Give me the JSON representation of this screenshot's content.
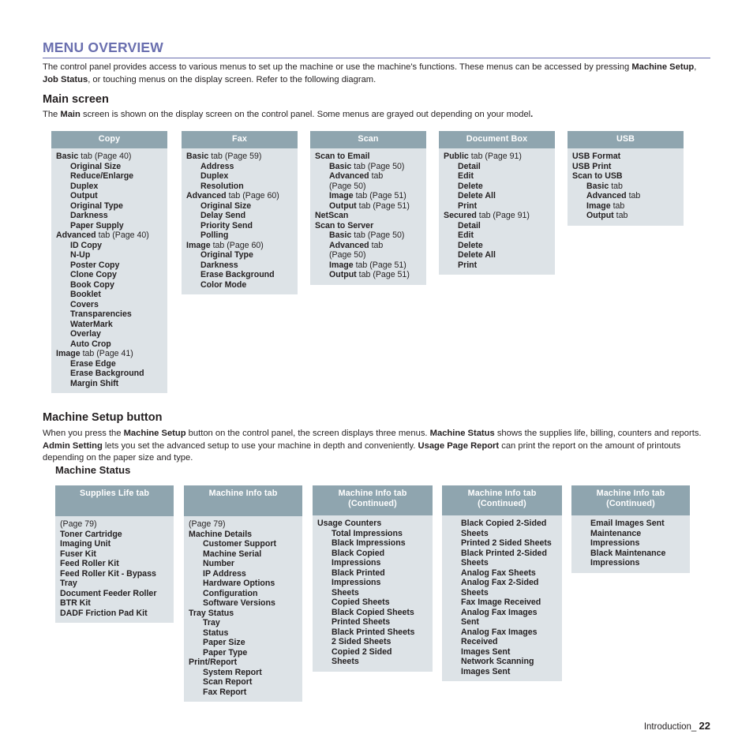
{
  "document": {
    "title": "MENU OVERVIEW",
    "intro_paragraph_html": "The control panel provides access to various menus to set up the machine or use the machine's functions. These menus can be accessed by pressing <b>Machine Setup</b>, <b>Job Status</b>, or touching menus on the display screen. Refer to the following diagram.",
    "main_screen_heading": "Main screen",
    "main_screen_paragraph_html": "The <b>Main</b> screen is shown on the display screen on the control panel. Some menus are grayed out depending on your model<b>.</b>",
    "machine_setup_heading": "Machine Setup button",
    "machine_setup_paragraph_html": "When you press the <b>Machine Setup</b> button on the control panel, the screen displays three menus. <b>Machine Status</b> shows the supplies life, billing, counters and reports. <b>Admin Setting</b> lets you set the advanced setup to use your machine in depth and conveniently. <b>Usage Page Report</b> can print the report on the amount of printouts depending on the paper size and type.",
    "machine_status_heading": "Machine Status",
    "footer_label": "Introduction_",
    "footer_page": "22"
  },
  "colors": {
    "heading_purple": "#6a6faf",
    "box_header_bg": "#8fa5af",
    "box_body_bg": "#dde3e7",
    "text": "#231f20"
  },
  "main_screen_columns": [
    {
      "header": "Copy",
      "items": [
        {
          "level": 0,
          "bold": "Basic",
          "rest": " tab (Page 40)"
        },
        {
          "level": 1,
          "bold": "Original Size",
          "rest": ""
        },
        {
          "level": 1,
          "bold": "Reduce/Enlarge",
          "rest": ""
        },
        {
          "level": 1,
          "bold": "Duplex",
          "rest": ""
        },
        {
          "level": 1,
          "bold": "Output",
          "rest": ""
        },
        {
          "level": 1,
          "bold": "Original Type",
          "rest": ""
        },
        {
          "level": 1,
          "bold": "Darkness",
          "rest": ""
        },
        {
          "level": 1,
          "bold": "Paper Supply",
          "rest": ""
        },
        {
          "level": 0,
          "bold": "Advanced",
          "rest": " tab (Page 40)"
        },
        {
          "level": 1,
          "bold": "ID Copy",
          "rest": ""
        },
        {
          "level": 1,
          "bold": "N-Up",
          "rest": ""
        },
        {
          "level": 1,
          "bold": "Poster Copy",
          "rest": ""
        },
        {
          "level": 1,
          "bold": "Clone Copy",
          "rest": ""
        },
        {
          "level": 1,
          "bold": "Book Copy",
          "rest": ""
        },
        {
          "level": 1,
          "bold": "Booklet",
          "rest": ""
        },
        {
          "level": 1,
          "bold": "Covers",
          "rest": ""
        },
        {
          "level": 1,
          "bold": "Transparencies",
          "rest": ""
        },
        {
          "level": 1,
          "bold": "WaterMark",
          "rest": ""
        },
        {
          "level": 1,
          "bold": "Overlay",
          "rest": ""
        },
        {
          "level": 1,
          "bold": "Auto Crop",
          "rest": ""
        },
        {
          "level": 0,
          "bold": "Image",
          "rest": " tab (Page 41)"
        },
        {
          "level": 1,
          "bold": "Erase Edge",
          "rest": ""
        },
        {
          "level": 1,
          "bold": "Erase Background",
          "rest": ""
        },
        {
          "level": 1,
          "bold": "Margin Shift",
          "rest": ""
        }
      ]
    },
    {
      "header": "Fax",
      "items": [
        {
          "level": 0,
          "bold": "Basic",
          "rest": " tab (Page 59)"
        },
        {
          "level": 1,
          "bold": "Address",
          "rest": ""
        },
        {
          "level": 1,
          "bold": "Duplex",
          "rest": ""
        },
        {
          "level": 1,
          "bold": "Resolution",
          "rest": ""
        },
        {
          "level": 0,
          "bold": "Advanced",
          "rest": " tab (Page 60)"
        },
        {
          "level": 1,
          "bold": "Original Size",
          "rest": ""
        },
        {
          "level": 1,
          "bold": "Delay Send",
          "rest": ""
        },
        {
          "level": 1,
          "bold": "Priority Send",
          "rest": ""
        },
        {
          "level": 1,
          "bold": "Polling",
          "rest": ""
        },
        {
          "level": 0,
          "bold": "Image",
          "rest": " tab (Page 60)"
        },
        {
          "level": 1,
          "bold": "Original Type",
          "rest": ""
        },
        {
          "level": 1,
          "bold": "Darkness",
          "rest": ""
        },
        {
          "level": 1,
          "bold": "Erase Background",
          "rest": ""
        },
        {
          "level": 1,
          "bold": "Color Mode",
          "rest": ""
        }
      ]
    },
    {
      "header": "Scan",
      "items": [
        {
          "level": 0,
          "bold": "Scan to Email",
          "rest": ""
        },
        {
          "level": 1,
          "bold": "Basic",
          "rest": " tab (Page 50)"
        },
        {
          "level": 1,
          "bold": "Advanced",
          "rest": " tab"
        },
        {
          "level": 1,
          "bold": "",
          "rest": "(Page 50)"
        },
        {
          "level": 1,
          "bold": "Image",
          "rest": " tab (Page 51)"
        },
        {
          "level": 1,
          "bold": "Output",
          "rest": " tab (Page 51)"
        },
        {
          "level": 0,
          "bold": "NetScan",
          "rest": ""
        },
        {
          "level": 0,
          "bold": "Scan to Server",
          "rest": ""
        },
        {
          "level": 1,
          "bold": "Basic",
          "rest": " tab (Page 50)"
        },
        {
          "level": 1,
          "bold": "Advanced",
          "rest": " tab"
        },
        {
          "level": 1,
          "bold": "",
          "rest": "(Page 50)"
        },
        {
          "level": 1,
          "bold": "Image",
          "rest": " tab (Page 51)"
        },
        {
          "level": 1,
          "bold": "Output",
          "rest": " tab (Page 51)"
        }
      ]
    },
    {
      "header": "Document Box",
      "items": [
        {
          "level": 0,
          "bold": "Public",
          "rest": " tab (Page 91)"
        },
        {
          "level": 1,
          "bold": "Detail",
          "rest": ""
        },
        {
          "level": 1,
          "bold": "Edit",
          "rest": ""
        },
        {
          "level": 1,
          "bold": "Delete",
          "rest": ""
        },
        {
          "level": 1,
          "bold": "Delete All",
          "rest": ""
        },
        {
          "level": 1,
          "bold": "Print",
          "rest": ""
        },
        {
          "level": 0,
          "bold": "Secured",
          "rest": " tab (Page 91)"
        },
        {
          "level": 1,
          "bold": "Detail",
          "rest": ""
        },
        {
          "level": 1,
          "bold": "Edit",
          "rest": ""
        },
        {
          "level": 1,
          "bold": "Delete",
          "rest": ""
        },
        {
          "level": 1,
          "bold": "Delete All",
          "rest": ""
        },
        {
          "level": 1,
          "bold": "Print",
          "rest": ""
        }
      ]
    },
    {
      "header": "USB",
      "items": [
        {
          "level": 0,
          "bold": "USB Format",
          "rest": ""
        },
        {
          "level": 0,
          "bold": "USB Print",
          "rest": ""
        },
        {
          "level": 0,
          "bold": "Scan to USB",
          "rest": ""
        },
        {
          "level": 1,
          "bold": "Basic",
          "rest": " tab"
        },
        {
          "level": 1,
          "bold": "Advanced",
          "rest": " tab"
        },
        {
          "level": 1,
          "bold": "Image",
          "rest": " tab"
        },
        {
          "level": 1,
          "bold": "Output",
          "rest": " tab"
        }
      ]
    }
  ],
  "machine_status_columns": [
    {
      "header": "Supplies Life tab",
      "header_sub": "",
      "items": [
        {
          "level": 0,
          "bold": "",
          "rest": "(Page 79)"
        },
        {
          "level": 0,
          "bold": "Toner Cartridge",
          "rest": ""
        },
        {
          "level": 0,
          "bold": "Imaging Unit",
          "rest": ""
        },
        {
          "level": 0,
          "bold": "Fuser Kit",
          "rest": ""
        },
        {
          "level": 0,
          "bold": "Feed Roller Kit",
          "rest": ""
        },
        {
          "level": 0,
          "bold": "Feed Roller Kit - Bypass",
          "rest": ""
        },
        {
          "level": 0,
          "bold": "Tray",
          "rest": ""
        },
        {
          "level": 0,
          "bold": "Document Feeder Roller",
          "rest": ""
        },
        {
          "level": 0,
          "bold": "BTR Kit",
          "rest": ""
        },
        {
          "level": 0,
          "bold": "DADF Friction Pad Kit",
          "rest": ""
        }
      ]
    },
    {
      "header": "Machine Info tab",
      "header_sub": "",
      "items": [
        {
          "level": 0,
          "bold": "",
          "rest": "(Page 79)"
        },
        {
          "level": 0,
          "bold": "Machine Details",
          "rest": ""
        },
        {
          "level": 1,
          "bold": "Customer Support",
          "rest": ""
        },
        {
          "level": 1,
          "bold": "Machine Serial",
          "rest": ""
        },
        {
          "level": 1,
          "bold": "Number",
          "rest": ""
        },
        {
          "level": 1,
          "bold": "IP Address",
          "rest": ""
        },
        {
          "level": 1,
          "bold": "Hardware Options",
          "rest": ""
        },
        {
          "level": 1,
          "bold": "Configuration",
          "rest": ""
        },
        {
          "level": 1,
          "bold": "Software Versions",
          "rest": ""
        },
        {
          "level": 0,
          "bold": "Tray Status",
          "rest": ""
        },
        {
          "level": 1,
          "bold": "Tray",
          "rest": ""
        },
        {
          "level": 1,
          "bold": "Status",
          "rest": ""
        },
        {
          "level": 1,
          "bold": "Paper Size",
          "rest": ""
        },
        {
          "level": 1,
          "bold": "Paper Type",
          "rest": ""
        },
        {
          "level": 0,
          "bold": "Print/Report",
          "rest": ""
        },
        {
          "level": 1,
          "bold": "System Report",
          "rest": ""
        },
        {
          "level": 1,
          "bold": "Scan Report",
          "rest": ""
        },
        {
          "level": 1,
          "bold": "Fax Report",
          "rest": ""
        }
      ]
    },
    {
      "header": "Machine Info tab",
      "header_sub": "(Continued)",
      "items": [
        {
          "level": 0,
          "bold": "Usage Counters",
          "rest": ""
        },
        {
          "level": 1,
          "bold": "Total Impressions",
          "rest": ""
        },
        {
          "level": 1,
          "bold": "Black Impressions",
          "rest": ""
        },
        {
          "level": 1,
          "bold": "Black Copied",
          "rest": ""
        },
        {
          "level": 1,
          "bold": "Impressions",
          "rest": ""
        },
        {
          "level": 1,
          "bold": "Black Printed",
          "rest": ""
        },
        {
          "level": 1,
          "bold": "Impressions",
          "rest": ""
        },
        {
          "level": 1,
          "bold": "Sheets",
          "rest": ""
        },
        {
          "level": 1,
          "bold": "Copied Sheets",
          "rest": ""
        },
        {
          "level": 1,
          "bold": "Black Copied Sheets",
          "rest": ""
        },
        {
          "level": 1,
          "bold": "Printed Sheets",
          "rest": ""
        },
        {
          "level": 1,
          "bold": "Black Printed Sheets",
          "rest": ""
        },
        {
          "level": 1,
          "bold": "2 Sided Sheets",
          "rest": ""
        },
        {
          "level": 1,
          "bold": "Copied 2 Sided",
          "rest": ""
        },
        {
          "level": 1,
          "bold": "Sheets",
          "rest": ""
        }
      ]
    },
    {
      "header": "Machine Info tab",
      "header_sub": "(Continued)",
      "items": [
        {
          "level": 1,
          "bold": "Black Copied 2-Sided",
          "rest": ""
        },
        {
          "level": 1,
          "bold": "Sheets",
          "rest": ""
        },
        {
          "level": 1,
          "bold": "Printed 2 Sided Sheets",
          "rest": ""
        },
        {
          "level": 1,
          "bold": "Black Printed 2-Sided",
          "rest": ""
        },
        {
          "level": 1,
          "bold": "Sheets",
          "rest": ""
        },
        {
          "level": 1,
          "bold": "Analog Fax Sheets",
          "rest": ""
        },
        {
          "level": 1,
          "bold": "Analog Fax 2-Sided",
          "rest": ""
        },
        {
          "level": 1,
          "bold": "Sheets",
          "rest": ""
        },
        {
          "level": 1,
          "bold": "Fax Image Received",
          "rest": ""
        },
        {
          "level": 1,
          "bold": "Analog Fax Images",
          "rest": ""
        },
        {
          "level": 1,
          "bold": "Sent",
          "rest": ""
        },
        {
          "level": 1,
          "bold": "Analog Fax Images",
          "rest": ""
        },
        {
          "level": 1,
          "bold": "Received",
          "rest": ""
        },
        {
          "level": 1,
          "bold": "Images Sent",
          "rest": ""
        },
        {
          "level": 1,
          "bold": "Network Scanning",
          "rest": ""
        },
        {
          "level": 1,
          "bold": "Images Sent",
          "rest": ""
        }
      ]
    },
    {
      "header": "Machine Info tab",
      "header_sub": "(Continued)",
      "items": [
        {
          "level": 1,
          "bold": "Email Images Sent",
          "rest": ""
        },
        {
          "level": 1,
          "bold": "Maintenance",
          "rest": ""
        },
        {
          "level": 1,
          "bold": "Impressions",
          "rest": ""
        },
        {
          "level": 1,
          "bold": "Black Maintenance",
          "rest": ""
        },
        {
          "level": 1,
          "bold": "Impressions",
          "rest": ""
        }
      ]
    }
  ]
}
